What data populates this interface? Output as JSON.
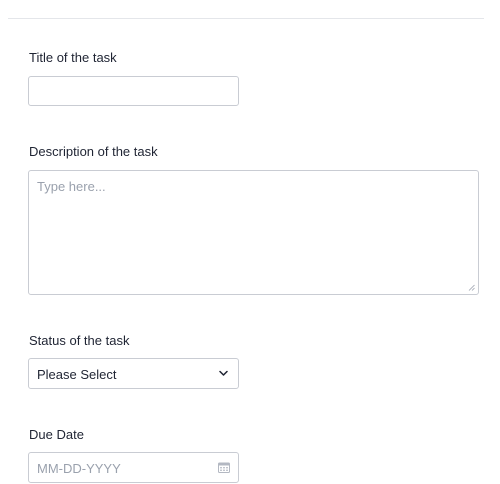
{
  "form": {
    "title_field": {
      "label": "Title of the task",
      "value": "",
      "placeholder": ""
    },
    "description_field": {
      "label": "Description of the task",
      "value": "",
      "placeholder": "Type here..."
    },
    "status_field": {
      "label": "Status of the task",
      "selected_value": "Please Select",
      "icon": "chevron-down-icon"
    },
    "due_date_field": {
      "label": "Due Date",
      "value": "",
      "placeholder": "MM-DD-YYYY",
      "icon": "calendar-icon"
    }
  },
  "colors": {
    "border": "#c9ccd3",
    "label_text": "#1f2433",
    "placeholder_text": "#9aa1ad",
    "divider": "#e4e6ea"
  }
}
